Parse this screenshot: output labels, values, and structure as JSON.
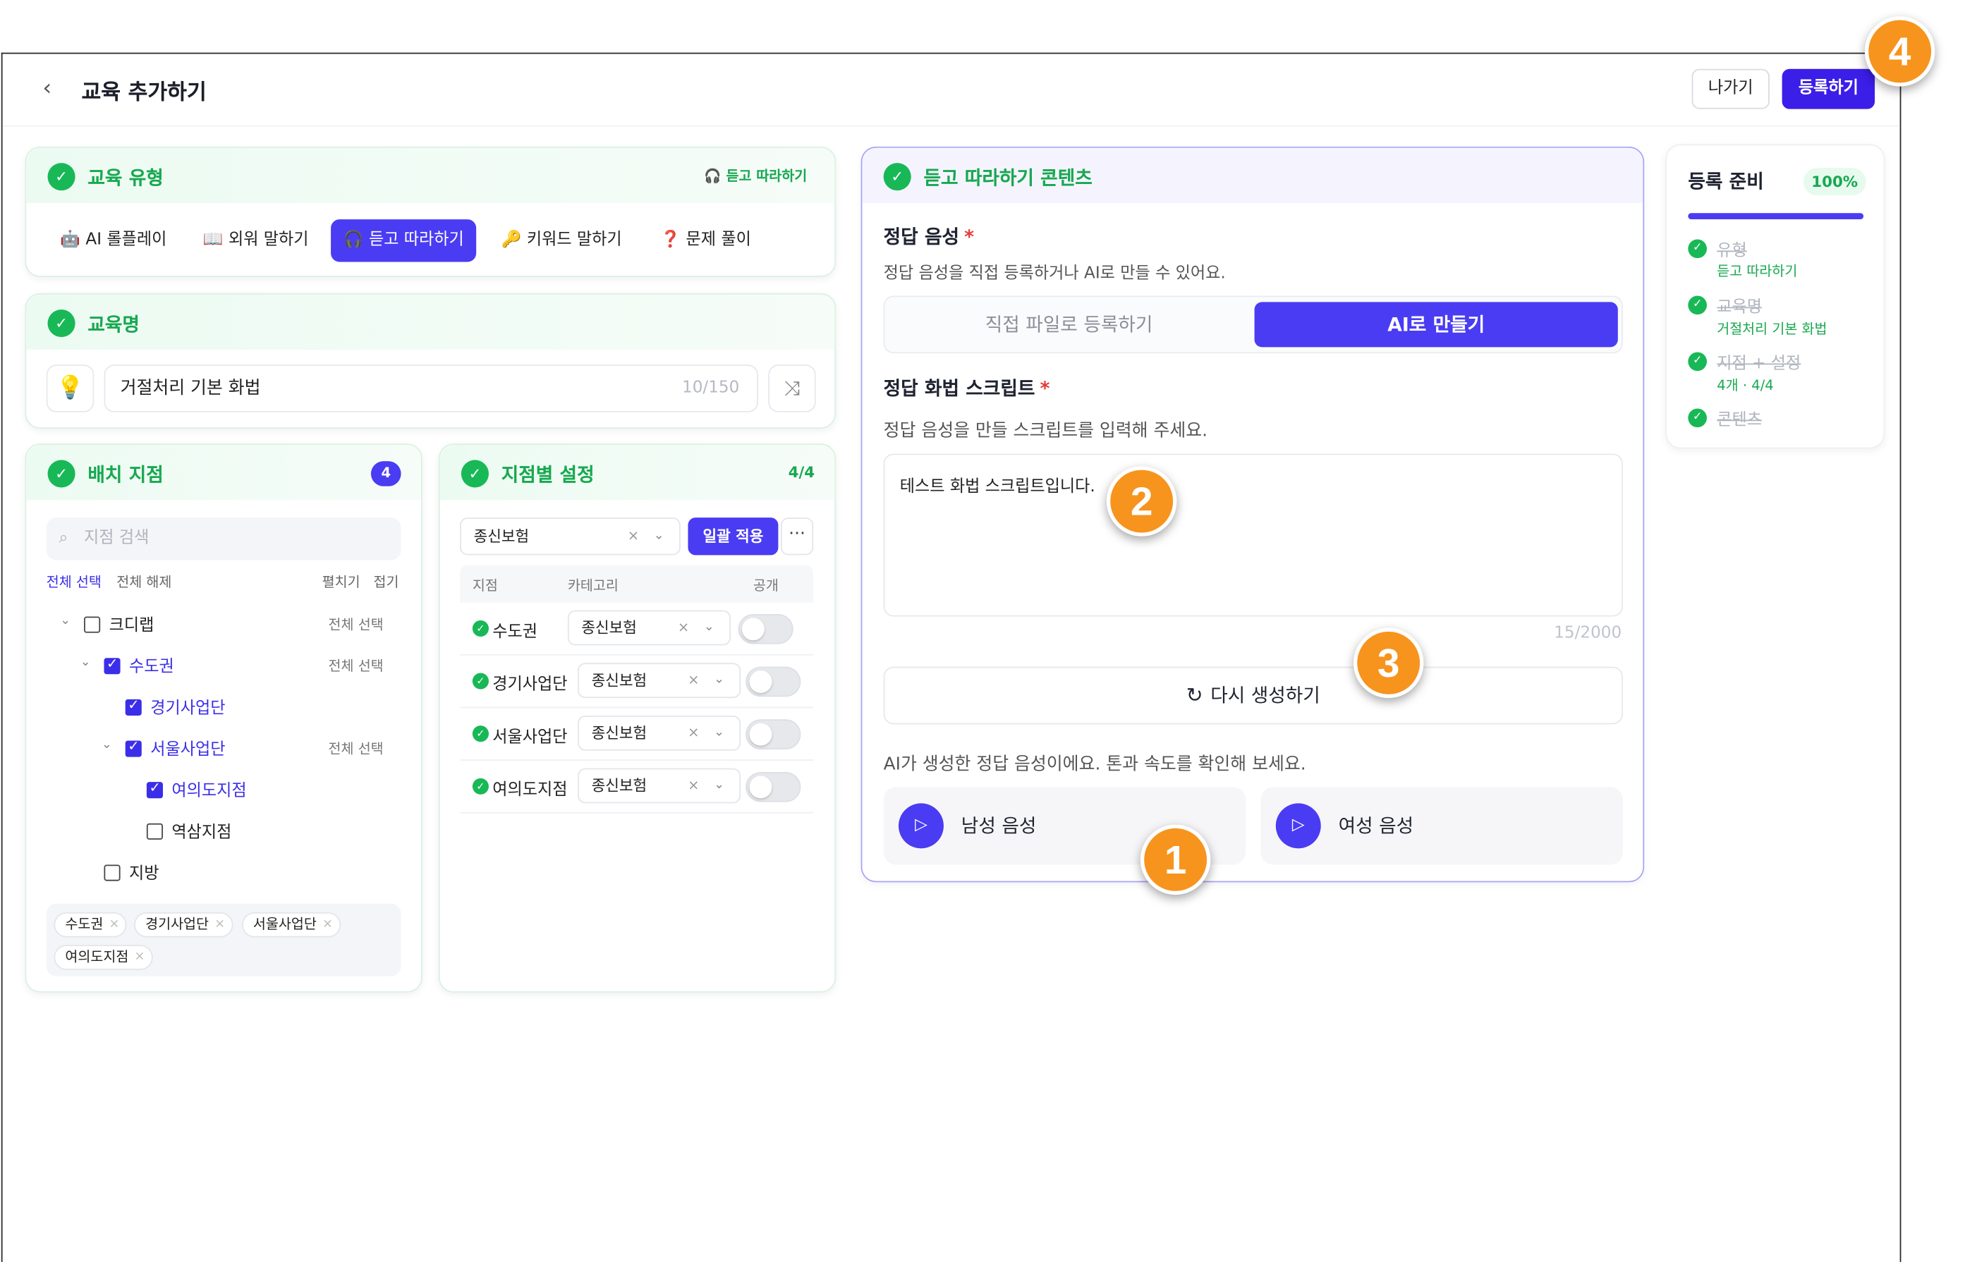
{
  "header": {
    "title": "교육 추가하기",
    "exit_label": "나가기",
    "register_label": "등록하기"
  },
  "edu_type": {
    "title": "교육 유형",
    "selected_tag": "듣고 따라하기",
    "tabs": [
      {
        "icon": "🤖",
        "label": "AI 롤플레이",
        "active": false
      },
      {
        "icon": "📖",
        "label": "외워 말하기",
        "active": false
      },
      {
        "icon": "🎧",
        "label": "듣고 따라하기",
        "active": true
      },
      {
        "icon": "🔑",
        "label": "키워드 말하기",
        "active": false
      },
      {
        "icon": "❓",
        "label": "문제 풀이",
        "active": false
      }
    ]
  },
  "edu_name": {
    "title": "교육명",
    "value": "거절처리 기본 화법",
    "count": "10/150"
  },
  "branches": {
    "title": "배치 지점",
    "count": "4",
    "search_placeholder": "지점 검색",
    "select_all": "전체 선택",
    "deselect_all": "전체 해제",
    "expand": "펼치기",
    "collapse": "접기",
    "row_all_label": "전체 선택",
    "tree": [
      {
        "label": "크디랩",
        "checked": false
      },
      {
        "label": "수도권",
        "checked": true
      },
      {
        "label": "경기사업단",
        "checked": true
      },
      {
        "label": "서울사업단",
        "checked": true
      },
      {
        "label": "여의도지점",
        "checked": true
      },
      {
        "label": "역삼지점",
        "checked": false
      },
      {
        "label": "지방",
        "checked": false
      }
    ],
    "chips": [
      "수도권",
      "경기사업단",
      "서울사업단",
      "여의도지점"
    ]
  },
  "branch_settings": {
    "title": "지점별 설정",
    "count": "4/4",
    "bulk_category": "종신보험",
    "bulk_apply": "일괄 적용",
    "more": "···",
    "columns": [
      "지점",
      "카테고리",
      "공개"
    ],
    "rows": [
      {
        "name": "수도권",
        "category": "종신보험"
      },
      {
        "name": "경기사업단",
        "category": "종신보험"
      },
      {
        "name": "서울사업단",
        "category": "종신보험"
      },
      {
        "name": "여의도지점",
        "category": "종신보험"
      }
    ]
  },
  "content": {
    "title": "듣고 따라하기 콘텐츠",
    "answer_voice_label": "정답 음성",
    "answer_voice_desc": "정답 음성을 직접 등록하거나 AI로 만들 수 있어요.",
    "seg_file": "직접 파일로 등록하기",
    "seg_ai": "AI로 만들기",
    "script_label": "정답 화법 스크립트",
    "script_desc": "정답 음성을 만들 스크립트를 입력해 주세요.",
    "script_value": "테스트 화법 스크립트입니다.",
    "script_count": "15/2000",
    "regen_label": "다시 생성하기",
    "ai_desc": "AI가 생성한 정답 음성이에요. 톤과 속도를 확인해 보세요.",
    "male_voice": "남성 음성",
    "female_voice": "여성 음성",
    "required_mark": "*"
  },
  "progress": {
    "title": "등록 준비",
    "percent_label": "100%",
    "percent": 100,
    "steps": [
      {
        "name": "유형",
        "value": "듣고 따라하기"
      },
      {
        "name": "교육명",
        "value": "거절처리 기본 화법"
      },
      {
        "name": "지점 + 설정",
        "value": "4개 · 4/4"
      },
      {
        "name": "콘텐츠",
        "value": ""
      }
    ]
  },
  "markers": [
    "1",
    "2",
    "3",
    "4"
  ],
  "colors": {
    "accent": "#4a3cf2",
    "success": "#19b857",
    "marker": "#f7941d"
  }
}
